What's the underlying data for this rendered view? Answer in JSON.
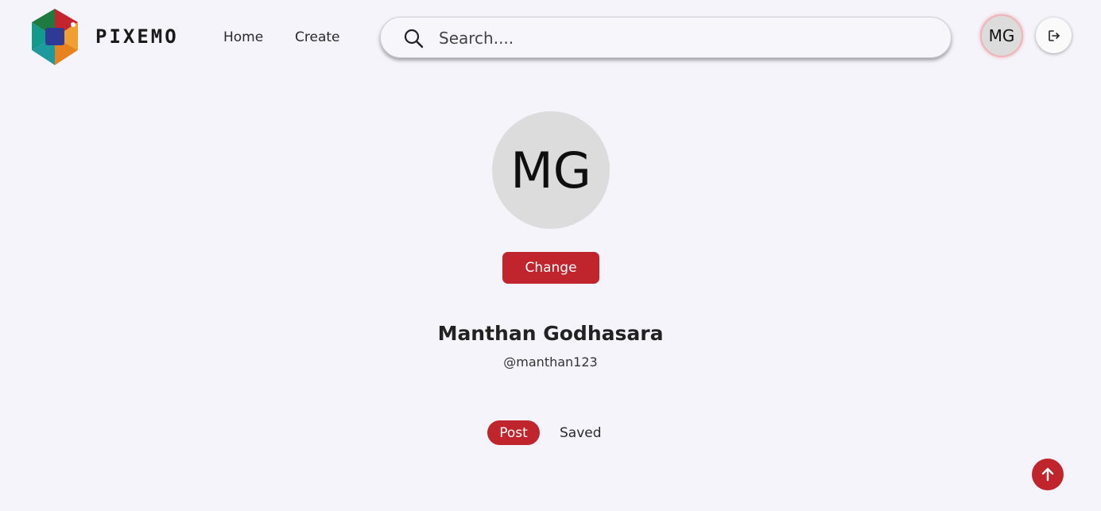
{
  "brand": {
    "name": "PIXEMO",
    "logo_icon": "camera-aperture-logo"
  },
  "nav": [
    {
      "label": "Home"
    },
    {
      "label": "Create"
    }
  ],
  "search": {
    "placeholder": "Search....",
    "value": "",
    "icon": "search-icon"
  },
  "user_menu": {
    "initials": "MG",
    "logout_icon": "logout-icon"
  },
  "profile": {
    "initials": "MG",
    "change_label": "Change",
    "name": "Manthan Godhasara",
    "handle": "@manthan123"
  },
  "tabs": [
    {
      "label": "Post",
      "active": true
    },
    {
      "label": "Saved",
      "active": false
    }
  ],
  "scroll_top_icon": "arrow-up-icon",
  "colors": {
    "accent": "#c0242c",
    "background": "#f5f4fa",
    "avatar_bg": "#dcdcdc"
  }
}
